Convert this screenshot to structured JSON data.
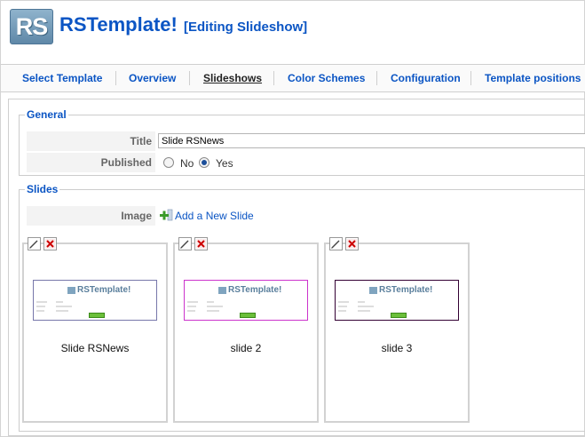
{
  "header": {
    "logo_text": "RS",
    "app_title": "RSTemplate!",
    "page_subtitle": "[Editing Slideshow]"
  },
  "tabs": [
    {
      "label": "Select Template",
      "active": false
    },
    {
      "label": "Overview",
      "active": false
    },
    {
      "label": "Slideshows",
      "active": true
    },
    {
      "label": "Color Schemes",
      "active": false
    },
    {
      "label": "Configuration",
      "active": false
    },
    {
      "label": "Template positions",
      "active": false
    }
  ],
  "general": {
    "legend": "General",
    "title_label": "Title",
    "title_value": "Slide RSNews",
    "published_label": "Published",
    "published_options": [
      "No",
      "Yes"
    ],
    "published_selected": "Yes"
  },
  "slides": {
    "legend": "Slides",
    "image_label": "Image",
    "add_link": "Add a New Slide",
    "items": [
      {
        "name": "Slide RSNews",
        "border_color": "#7777aa",
        "thumb_logo": "RSTemplate!"
      },
      {
        "name": "slide 2",
        "border_color": "#cc33cc",
        "thumb_logo": "RSTemplate!"
      },
      {
        "name": "slide 3",
        "border_color": "#330033",
        "thumb_logo": "RSTemplate!"
      }
    ]
  },
  "colors": {
    "accent": "#0b55c4",
    "add_icon": "#3a9a2a",
    "delete_icon": "#cc0000"
  },
  "icons": {
    "edit": "pencil-icon",
    "delete": "delete-x-icon",
    "add": "add-plus-icon"
  }
}
